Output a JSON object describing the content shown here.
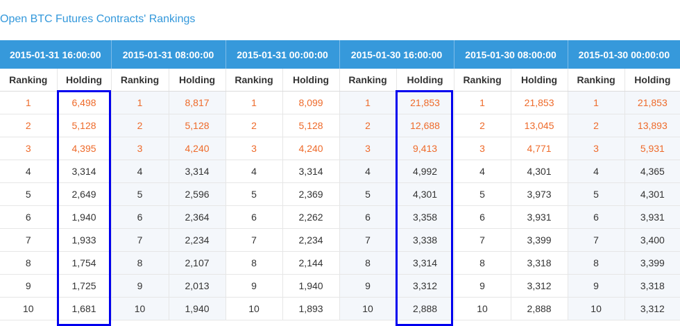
{
  "title": "Open BTC Futures Contracts' Rankings",
  "columns": [
    "Ranking",
    "Holding"
  ],
  "colors": {
    "header_bg": "#3699db",
    "title": "#3398db",
    "top3_text": "#ee6a2a",
    "highlight_box": "#0000ee"
  },
  "highlighted_columns": [
    "2015-01-31 16:00:00",
    "2015-01-30 16:00:00"
  ],
  "periods": [
    {
      "label": "2015-01-31 16:00:00",
      "rows": [
        {
          "rank": "1",
          "holding": "6,498"
        },
        {
          "rank": "2",
          "holding": "5,128"
        },
        {
          "rank": "3",
          "holding": "4,395"
        },
        {
          "rank": "4",
          "holding": "3,314"
        },
        {
          "rank": "5",
          "holding": "2,649"
        },
        {
          "rank": "6",
          "holding": "1,940"
        },
        {
          "rank": "7",
          "holding": "1,933"
        },
        {
          "rank": "8",
          "holding": "1,754"
        },
        {
          "rank": "9",
          "holding": "1,725"
        },
        {
          "rank": "10",
          "holding": "1,681"
        }
      ]
    },
    {
      "label": "2015-01-31 08:00:00",
      "rows": [
        {
          "rank": "1",
          "holding": "8,817"
        },
        {
          "rank": "2",
          "holding": "5,128"
        },
        {
          "rank": "3",
          "holding": "4,240"
        },
        {
          "rank": "4",
          "holding": "3,314"
        },
        {
          "rank": "5",
          "holding": "2,596"
        },
        {
          "rank": "6",
          "holding": "2,364"
        },
        {
          "rank": "7",
          "holding": "2,234"
        },
        {
          "rank": "8",
          "holding": "2,107"
        },
        {
          "rank": "9",
          "holding": "2,013"
        },
        {
          "rank": "10",
          "holding": "1,940"
        }
      ]
    },
    {
      "label": "2015-01-31 00:00:00",
      "rows": [
        {
          "rank": "1",
          "holding": "8,099"
        },
        {
          "rank": "2",
          "holding": "5,128"
        },
        {
          "rank": "3",
          "holding": "4,240"
        },
        {
          "rank": "4",
          "holding": "3,314"
        },
        {
          "rank": "5",
          "holding": "2,369"
        },
        {
          "rank": "6",
          "holding": "2,262"
        },
        {
          "rank": "7",
          "holding": "2,234"
        },
        {
          "rank": "8",
          "holding": "2,144"
        },
        {
          "rank": "9",
          "holding": "1,940"
        },
        {
          "rank": "10",
          "holding": "1,893"
        }
      ]
    },
    {
      "label": "2015-01-30 16:00:00",
      "rows": [
        {
          "rank": "1",
          "holding": "21,853"
        },
        {
          "rank": "2",
          "holding": "12,688"
        },
        {
          "rank": "3",
          "holding": "9,413"
        },
        {
          "rank": "4",
          "holding": "4,992"
        },
        {
          "rank": "5",
          "holding": "4,301"
        },
        {
          "rank": "6",
          "holding": "3,358"
        },
        {
          "rank": "7",
          "holding": "3,338"
        },
        {
          "rank": "8",
          "holding": "3,314"
        },
        {
          "rank": "9",
          "holding": "3,312"
        },
        {
          "rank": "10",
          "holding": "2,888"
        }
      ]
    },
    {
      "label": "2015-01-30 08:00:00",
      "rows": [
        {
          "rank": "1",
          "holding": "21,853"
        },
        {
          "rank": "2",
          "holding": "13,045"
        },
        {
          "rank": "3",
          "holding": "4,771"
        },
        {
          "rank": "4",
          "holding": "4,301"
        },
        {
          "rank": "5",
          "holding": "3,973"
        },
        {
          "rank": "6",
          "holding": "3,931"
        },
        {
          "rank": "7",
          "holding": "3,399"
        },
        {
          "rank": "8",
          "holding": "3,318"
        },
        {
          "rank": "9",
          "holding": "3,312"
        },
        {
          "rank": "10",
          "holding": "2,888"
        }
      ]
    },
    {
      "label": "2015-01-30 00:00:00",
      "rows": [
        {
          "rank": "1",
          "holding": "21,853"
        },
        {
          "rank": "2",
          "holding": "13,893"
        },
        {
          "rank": "3",
          "holding": "5,931"
        },
        {
          "rank": "4",
          "holding": "4,365"
        },
        {
          "rank": "5",
          "holding": "4,301"
        },
        {
          "rank": "6",
          "holding": "3,931"
        },
        {
          "rank": "7",
          "holding": "3,400"
        },
        {
          "rank": "8",
          "holding": "3,399"
        },
        {
          "rank": "9",
          "holding": "3,318"
        },
        {
          "rank": "10",
          "holding": "3,312"
        }
      ]
    }
  ]
}
